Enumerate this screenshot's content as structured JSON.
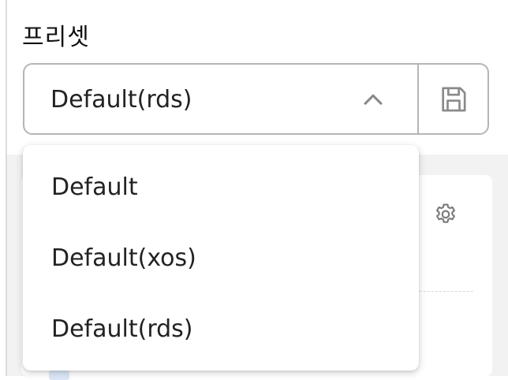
{
  "preset": {
    "label": "프리셋",
    "selected": "Default(rds)",
    "options": [
      "Default",
      "Default(xos)",
      "Default(rds)"
    ]
  },
  "icons": {
    "chevron": "chevron-up-icon",
    "save": "save-icon",
    "settings": "gear-icon"
  },
  "colors": {
    "border": "#b5b5b5",
    "backdrop": "#f2f2f2",
    "text": "#222222"
  }
}
